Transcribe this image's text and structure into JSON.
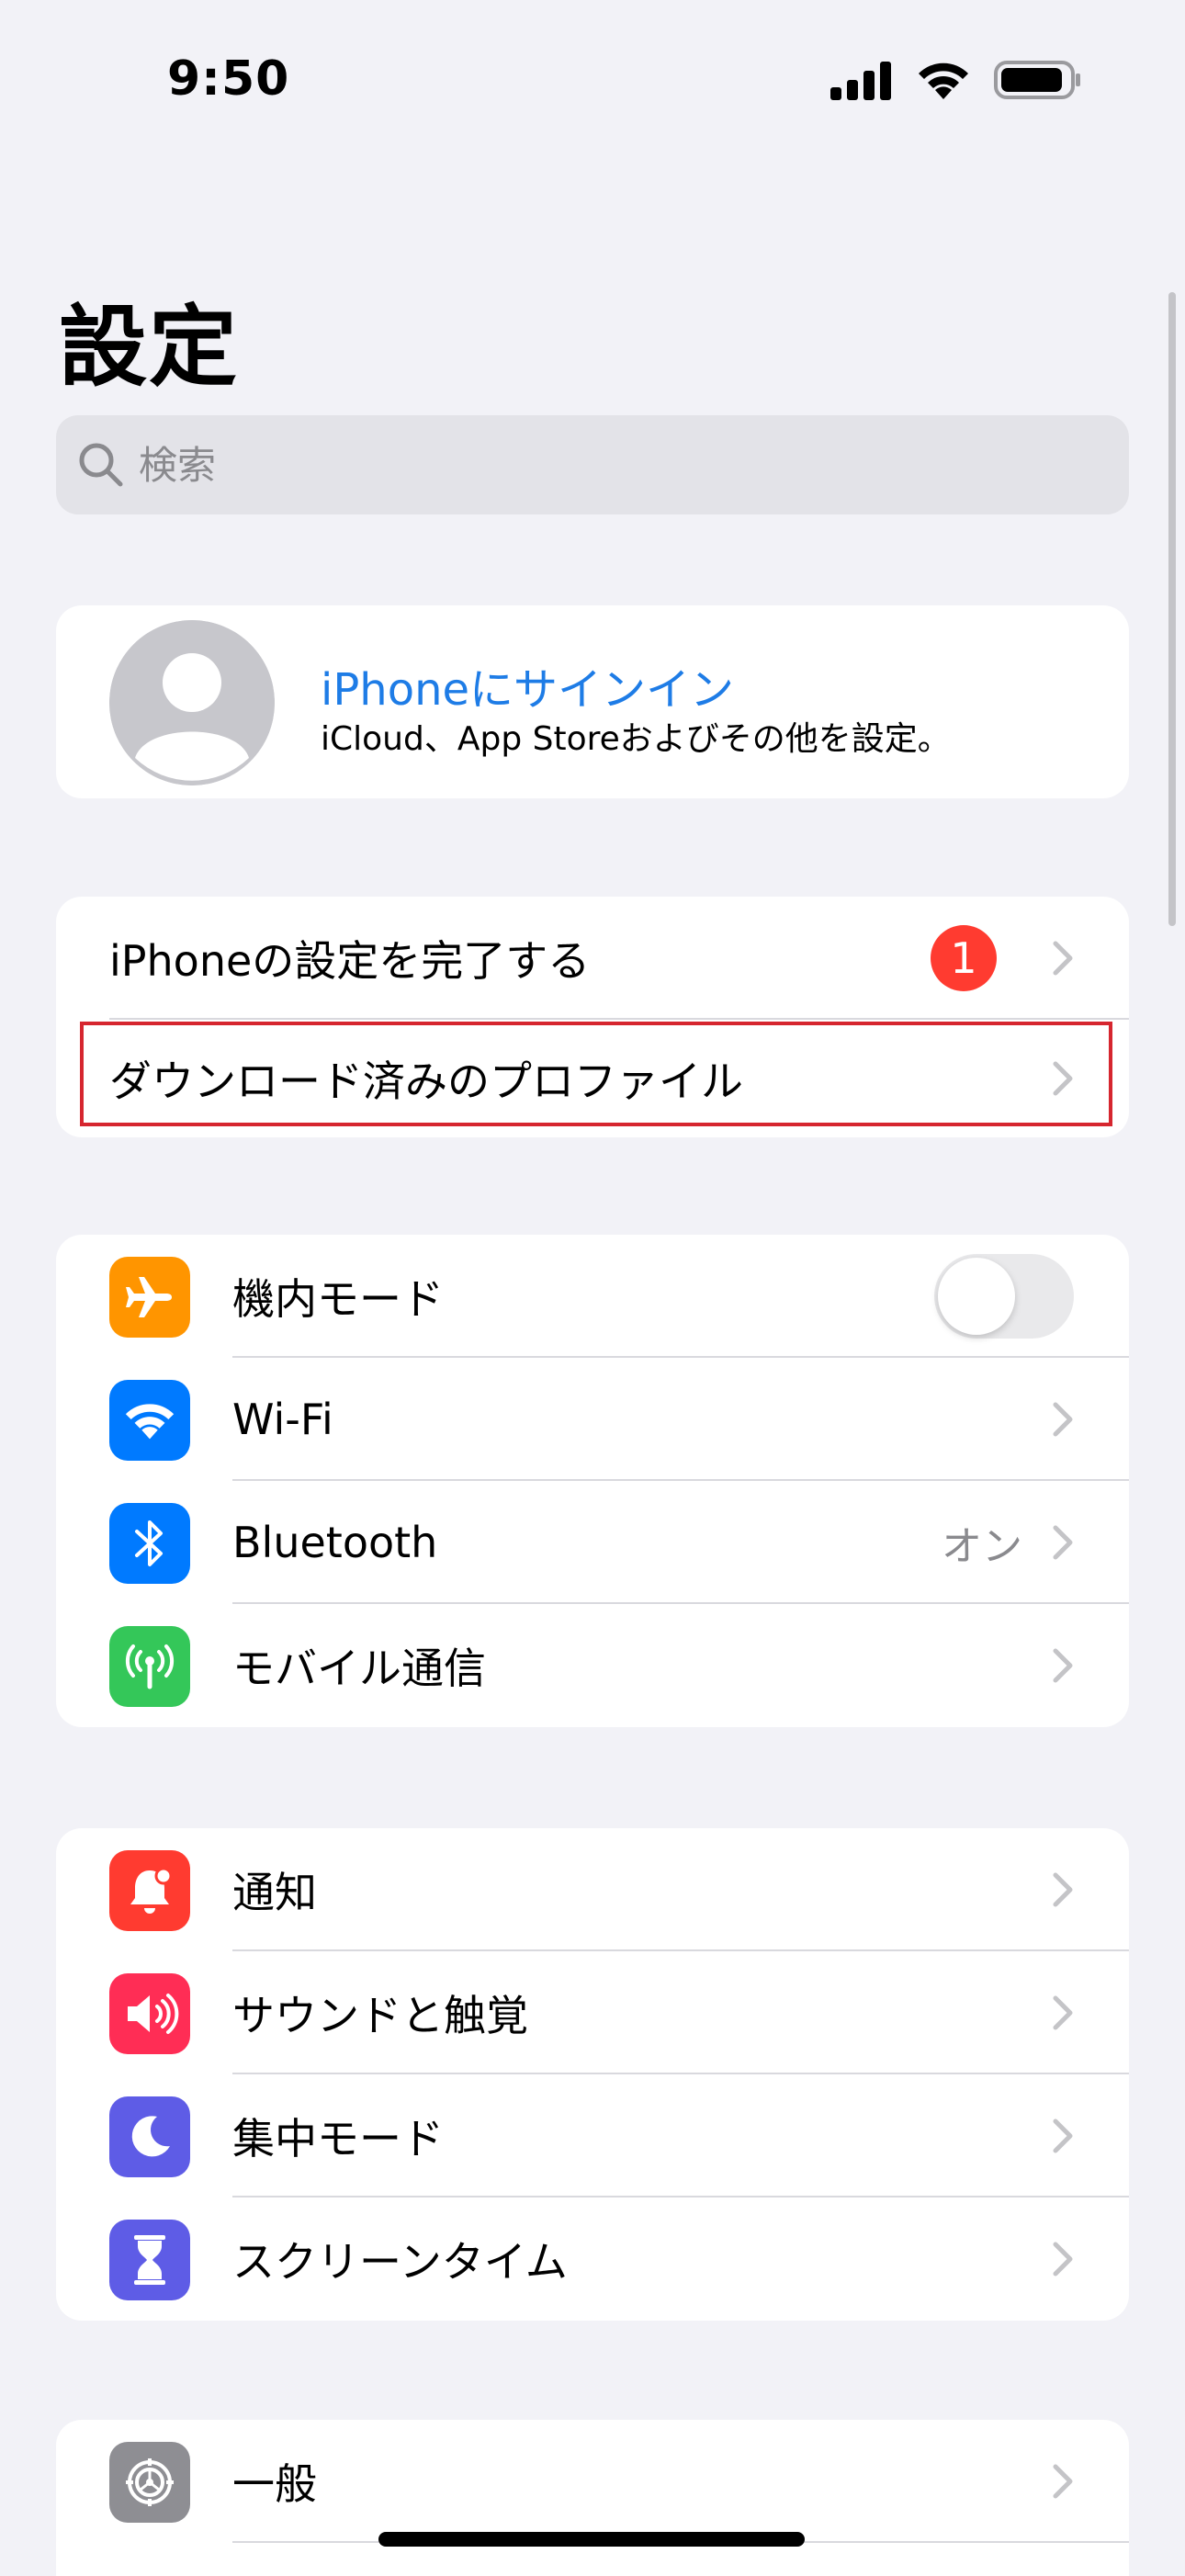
{
  "status_bar": {
    "time": "9:50"
  },
  "page": {
    "title": "設定"
  },
  "search": {
    "placeholder": "検索"
  },
  "profile": {
    "title": "iPhoneにサインイン",
    "subtitle": "iCloud、App Storeおよびその他を設定。"
  },
  "setup_group": {
    "items": [
      {
        "label": "iPhoneの設定を完了する",
        "badge": "1"
      },
      {
        "label": "ダウンロード済みのプロファイル"
      }
    ]
  },
  "connectivity_group": {
    "items": [
      {
        "label": "機内モード",
        "icon": "airplane-icon",
        "color": "#ff9500",
        "toggle": "off"
      },
      {
        "label": "Wi-Fi",
        "icon": "wifi-icon",
        "color": "#007aff"
      },
      {
        "label": "Bluetooth",
        "icon": "bluetooth-icon",
        "color": "#007aff",
        "value": "オン"
      },
      {
        "label": "モバイル通信",
        "icon": "antenna-icon",
        "color": "#34c759"
      }
    ]
  },
  "notifications_group": {
    "items": [
      {
        "label": "通知",
        "icon": "bell-icon",
        "color": "#ff3b30"
      },
      {
        "label": "サウンドと触覚",
        "icon": "speaker-icon",
        "color": "#ff2d55"
      },
      {
        "label": "集中モード",
        "icon": "moon-icon",
        "color": "#5e5ce6"
      },
      {
        "label": "スクリーンタイム",
        "icon": "hourglass-icon",
        "color": "#5e5ce6"
      }
    ]
  },
  "general_group": {
    "items": [
      {
        "label": "一般",
        "icon": "gear-icon",
        "color": "#8e8e93"
      }
    ]
  },
  "colors": {
    "accent": "#1e7ce6",
    "highlight_border": "#d6262f",
    "badge": "#ff3b30"
  }
}
